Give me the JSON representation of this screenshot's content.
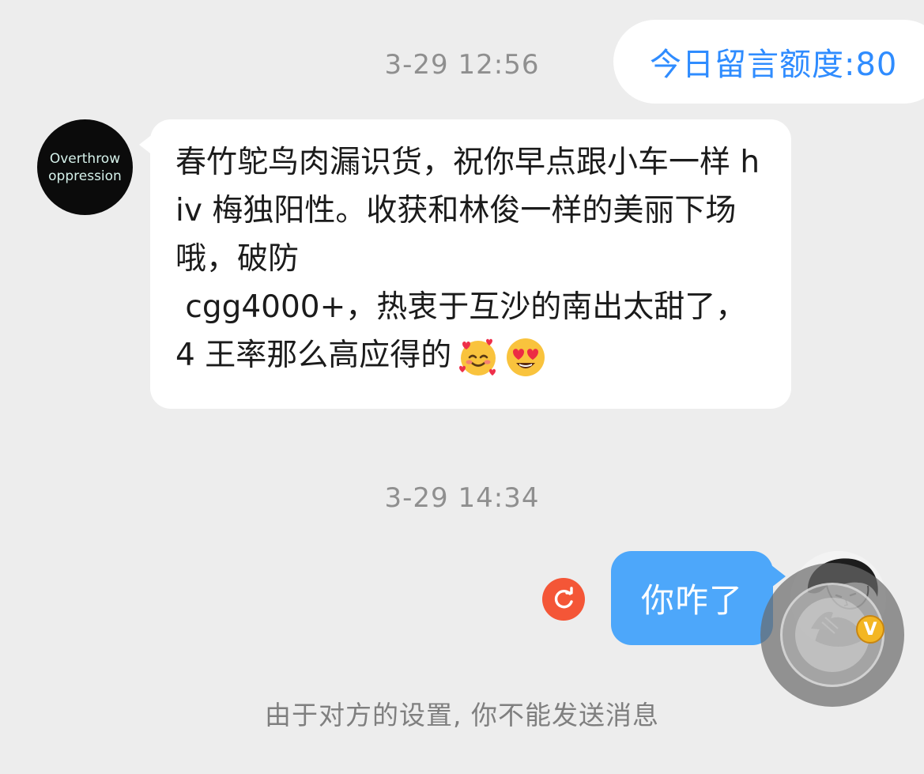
{
  "header": {
    "quota_label": "今日留言额度:80"
  },
  "messages": [
    {
      "timestamp": "3-29 12:56",
      "direction": "incoming",
      "avatar_text": "Overthrow\noppression",
      "text": "春竹鸵鸟肉漏识货，祝你早点跟小车一样 hiv 梅独阳性。收获和林俊一样的美丽下场哦，破防\n cgg4000+，热衷于互沙的南出太甜了，4 王率那么高应得的",
      "emojis": [
        "smiling-face-with-hearts-icon",
        "heart-eyes-icon"
      ]
    },
    {
      "timestamp": "3-29 14:34",
      "direction": "outgoing",
      "text": "你咋了",
      "status": "send-failed"
    }
  ],
  "footer": {
    "notice": "由于对方的设置, 你不能发送消息"
  },
  "colors": {
    "background": "#ededed",
    "accent_blue": "#2f8cff",
    "outgoing_bubble": "#4da7fa",
    "error_red": "#f45637"
  }
}
